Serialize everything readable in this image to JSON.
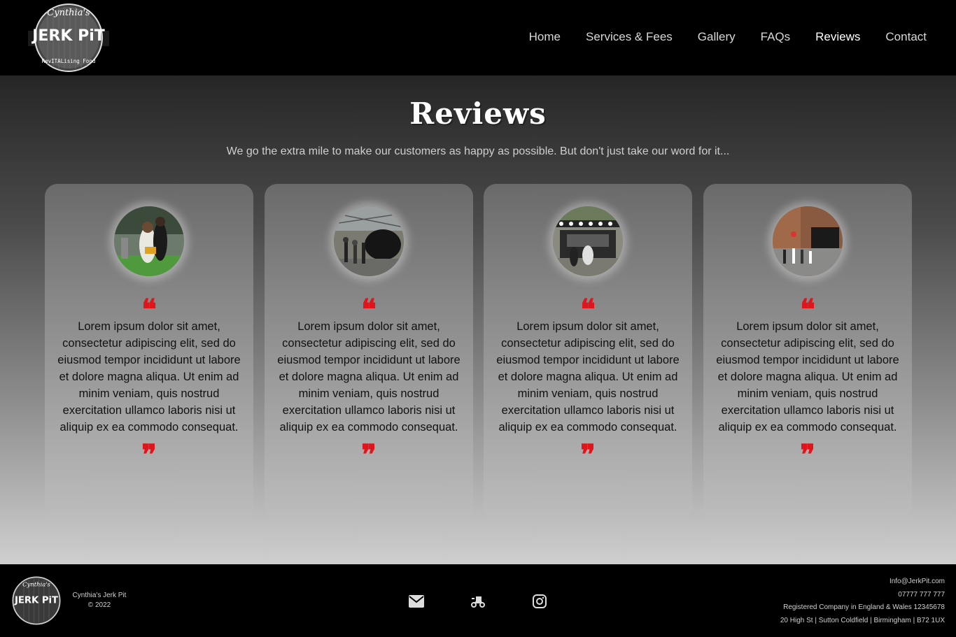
{
  "header": {
    "logo": {
      "top_text": "Cynthia's",
      "main_text": "JERK PiT",
      "bottom_text": "RevITALising Food"
    },
    "nav": [
      {
        "label": "Home",
        "active": false
      },
      {
        "label": "Services & Fees",
        "active": false
      },
      {
        "label": "Gallery",
        "active": false
      },
      {
        "label": "FAQs",
        "active": false
      },
      {
        "label": "Reviews",
        "active": true
      },
      {
        "label": "Contact",
        "active": false
      }
    ]
  },
  "main": {
    "title": "Reviews",
    "subtitle": "We go the extra mile to make our customers as happy as possible. But don't just take our word for it...",
    "reviews": [
      {
        "text": "Lorem ipsum dolor sit amet, consectetur adipiscing elit, sed do eiusmod tempor incididunt ut labore et dolore magna aliqua. Ut enim ad minim veniam, quis nostrud exercitation ullamco laboris nisi ut aliquip ex ea commodo consequat."
      },
      {
        "text": "Lorem ipsum dolor sit amet, consectetur adipiscing elit, sed do eiusmod tempor incididunt ut labore et dolore magna aliqua. Ut enim ad minim veniam, quis nostrud exercitation ullamco laboris nisi ut aliquip ex ea commodo consequat."
      },
      {
        "text": "Lorem ipsum dolor sit amet, consectetur adipiscing elit, sed do eiusmod tempor incididunt ut labore et dolore magna aliqua. Ut enim ad minim veniam, quis nostrud exercitation ullamco laboris nisi ut aliquip ex ea commodo consequat."
      },
      {
        "text": "Lorem ipsum dolor sit amet, consectetur adipiscing elit, sed do eiusmod tempor incididunt ut labore et dolore magna aliqua. Ut enim ad minim veniam, quis nostrud exercitation ullamco laboris nisi ut aliquip ex ea commodo consequat."
      }
    ],
    "quote_open": "❝",
    "quote_close": "❞"
  },
  "footer": {
    "brand_name": "Cynthia's Jerk Pit",
    "copyright": "© 2022",
    "icons": [
      "mail-icon",
      "delivery-scooter-icon",
      "instagram-icon"
    ],
    "email": "Info@JerkPit.com",
    "phone": "07777 777 777",
    "company": "Registered Company in England & Wales 12345678",
    "address": "20 High St | Sutton Coldfield | Birmingham | B72 1UX"
  },
  "colors": {
    "accent_red": "#e0151b",
    "header_bg": "#000000",
    "nav_text": "#d8d8d8",
    "nav_active": "#ffffff"
  }
}
